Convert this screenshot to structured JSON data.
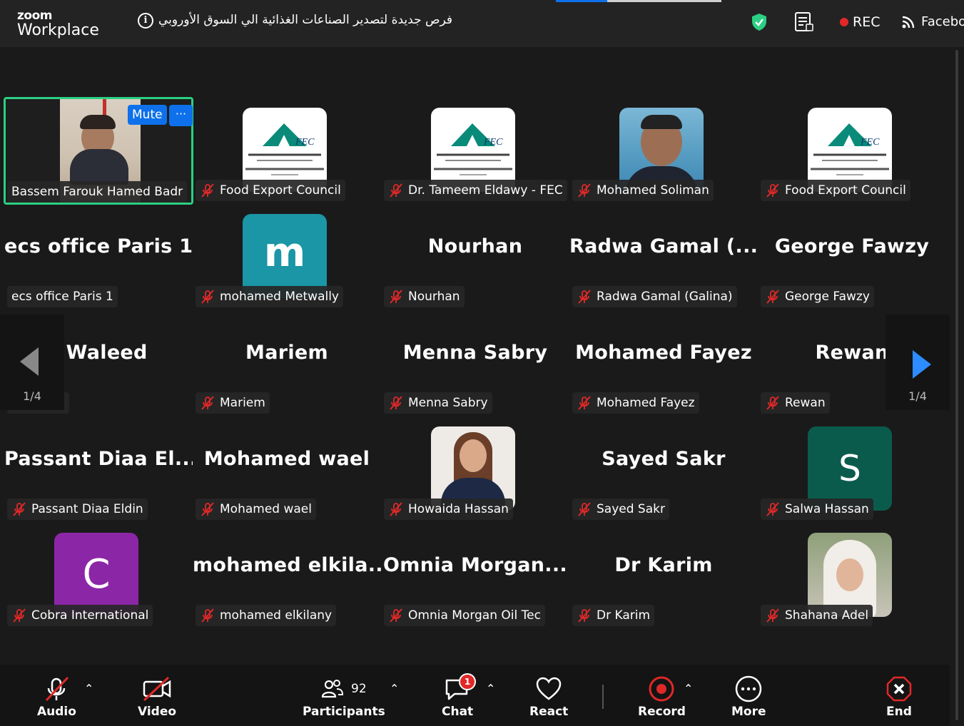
{
  "app": {
    "brand_top": "zoom",
    "brand_bottom": "Workplace"
  },
  "meeting": {
    "title": "فرص جديدة لتصدير الصناعات الغذائية الي السوق الأوروبي",
    "rec_label": "REC",
    "live_label": "Faceboo"
  },
  "active_tile": {
    "name": "Bassem Farouk Hamed Badr",
    "mute_label": "Mute",
    "more_label": "···"
  },
  "tiles": [
    {
      "display": "",
      "label": "Food Export Council",
      "avatar": "fec"
    },
    {
      "display": "",
      "label": "Dr. Tameem Eldawy - FEC",
      "avatar": "fec"
    },
    {
      "display": "",
      "label": "Mohamed Soliman",
      "avatar": "photo-man"
    },
    {
      "display": "",
      "label": "Food Export Council",
      "avatar": "fec"
    },
    {
      "display": "ecs office Paris 1",
      "label": "ecs office Paris 1",
      "avatar": "none"
    },
    {
      "display": "m",
      "label": "mohamed Metwally",
      "avatar": "letter-m"
    },
    {
      "display": "Nourhan",
      "label": "Nourhan",
      "avatar": "none"
    },
    {
      "display": "Radwa  Gamal  (...",
      "label": "Radwa Gamal (Galina)",
      "avatar": "none"
    },
    {
      "display": "George Fawzy",
      "label": "George Fawzy",
      "avatar": "none"
    },
    {
      "display": "r Waleed",
      "label": "aleed",
      "avatar": "none"
    },
    {
      "display": "Mariem",
      "label": "Mariem",
      "avatar": "none"
    },
    {
      "display": "Menna Sabry",
      "label": "Menna Sabry",
      "avatar": "none"
    },
    {
      "display": "Mohamed Fayez",
      "label": "Mohamed Fayez",
      "avatar": "none"
    },
    {
      "display": "Rewan",
      "label": "Rewan",
      "avatar": "none"
    },
    {
      "display": "Passant  Diaa  El...",
      "label": "Passant Diaa Eldin",
      "avatar": "none"
    },
    {
      "display": "Mohamed  wael",
      "label": "Mohamed  wael",
      "avatar": "none"
    },
    {
      "display": "",
      "label": "Howaida Hassan",
      "avatar": "photo-woman"
    },
    {
      "display": "Sayed Sakr",
      "label": "Sayed Sakr",
      "avatar": "none"
    },
    {
      "display": "S",
      "label": "Salwa Hassan",
      "avatar": "letter-s"
    },
    {
      "display": "C",
      "label": "Cobra International",
      "avatar": "letter-c"
    },
    {
      "display": "mohamed  elkila...",
      "label": "mohamed elkilany",
      "avatar": "none"
    },
    {
      "display": "Omnia  Morgan...",
      "label": "Omnia Morgan Oil Tec",
      "avatar": "none"
    },
    {
      "display": "Dr Karim",
      "label": "Dr Karim",
      "avatar": "none"
    },
    {
      "display": "",
      "label": "Shahana Adel",
      "avatar": "photo-hijab"
    }
  ],
  "pagination": {
    "left_page": "1/4",
    "right_page": "1/4"
  },
  "toolbar": {
    "audio": "Audio",
    "video": "Video",
    "participants": "Participants",
    "participants_count": "92",
    "chat": "Chat",
    "chat_badge": "1",
    "react": "React",
    "record": "Record",
    "more": "More",
    "end": "End"
  },
  "colors": {
    "accent": "#0e71eb",
    "active_border": "#2bd083",
    "muted_red": "#e02828"
  }
}
